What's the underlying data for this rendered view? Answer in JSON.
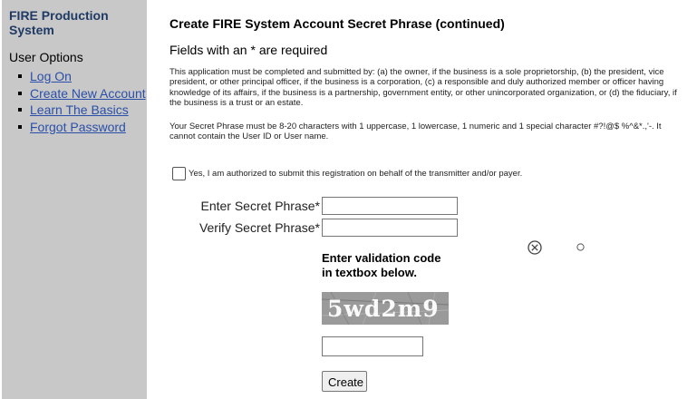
{
  "sidebar": {
    "system_title": "FIRE Production System",
    "user_options_heading": "User Options",
    "items": [
      {
        "label": "Log On"
      },
      {
        "label": "Create New Account"
      },
      {
        "label": "Learn The Basics"
      },
      {
        "label": "Forgot Password"
      }
    ]
  },
  "main": {
    "title": "Create FIRE System Account Secret Phrase (continued)",
    "required_note": "Fields with an * are required",
    "paragraph1": "This application must be completed and submitted by: (a) the owner, if the business is a sole proprietorship, (b) the president, vice president, or other principal officer, if the business is a corporation, (c) a responsible and duly authorized member or officer having knowledge of its affairs, if the business is a partnership, government entity, or other unincorporated organization, or (d) the fiduciary, if the business is a trust or an estate.",
    "paragraph2": "Your Secret Phrase must be 8-20 characters with 1 uppercase, 1 lowercase, 1 numeric and 1 special character #?!@$ %^&*.,'-. It cannot contain the User ID or User name.",
    "authorize_checkbox": {
      "label": "Yes, I am authorized to submit this registration on behalf of the transmitter and/or payer.",
      "checked": false
    },
    "secret_phrase_label": "Enter Secret Phrase*",
    "verify_phrase_label": "Verify Secret Phrase*",
    "secret_phrase_value": "",
    "verify_phrase_value": "",
    "validation_heading": "Enter validation code in textbox below.",
    "captcha_text": "5wd2m9",
    "validation_value": "",
    "create_button": "Create",
    "icons": {
      "refresh": "circle-x-icon",
      "audio": "small-circle-icon"
    }
  }
}
